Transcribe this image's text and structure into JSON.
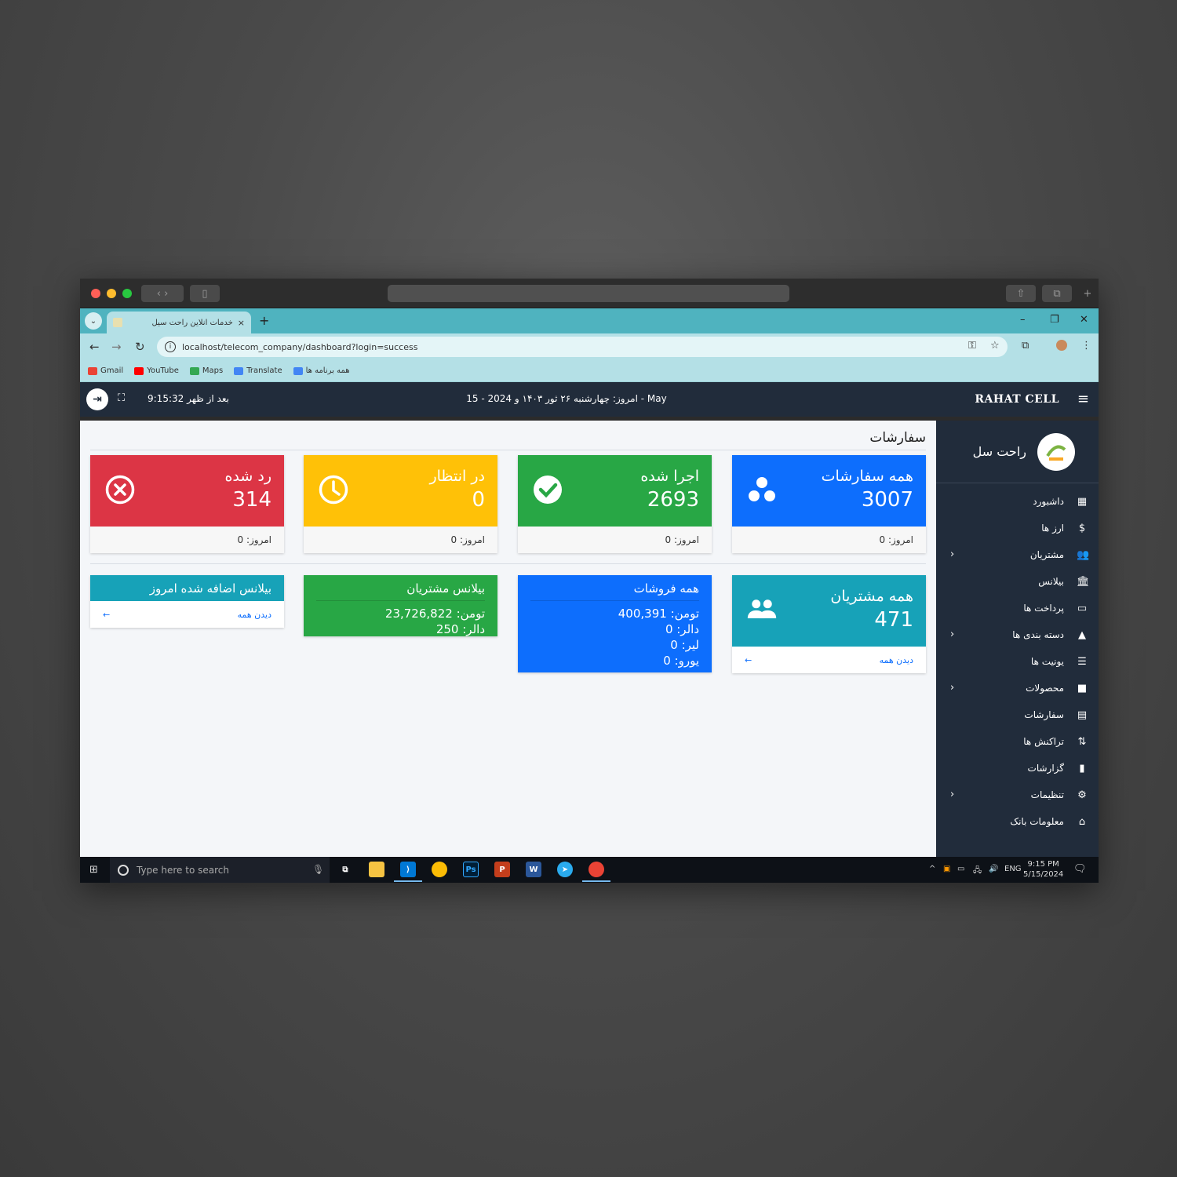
{
  "browser": {
    "tab_title": "خدمات آنلاین راحت سیل",
    "tab_close": "×",
    "new_tab": "+",
    "url": "localhost/telecom_company/dashboard?login=success",
    "bookmarks": [
      {
        "label": "Gmail",
        "color": "#ea4335"
      },
      {
        "label": "YouTube",
        "color": "#ff0000"
      },
      {
        "label": "Maps",
        "color": "#34a853"
      },
      {
        "label": "Translate",
        "color": "#4285f4"
      },
      {
        "label": "همه برنامه ها",
        "color": "#4285f4"
      }
    ]
  },
  "header": {
    "clock": "9:15:32 بعد از ظهر",
    "today": "امروز: چهارشنبه ۲۶ ثور ۱۴۰۳ و 2024 - 15 - May",
    "brand": "RAHAT CELL"
  },
  "page": {
    "title": "سفارشات"
  },
  "order_cards": [
    {
      "label": "همه سفارشات",
      "value": "3007",
      "today": "امروز: 0",
      "color": "#0d6efd",
      "icon": "circles-icon"
    },
    {
      "label": "اجرا شده",
      "value": "2693",
      "today": "امروز: 0",
      "color": "#28a745",
      "icon": "check-circle-icon"
    },
    {
      "label": "در انتظار",
      "value": "0",
      "today": "امروز: 0",
      "color": "#ffc107",
      "icon": "clock-icon"
    },
    {
      "label": "رد شده",
      "value": "314",
      "today": "امروز: 0",
      "color": "#dc3545",
      "icon": "x-circle-icon"
    }
  ],
  "customers_card": {
    "label": "همه مشتریان",
    "value": "471",
    "view_all": "دیدن همه",
    "color": "#17a2b8"
  },
  "sales_card": {
    "title": "همه فروشات",
    "lines": [
      "تومن: 400,391",
      "دالر: 0",
      "لیر: 0",
      "یورو: 0"
    ],
    "color": "#0d6efd"
  },
  "balance_card": {
    "title": "بیلانس مشتریان",
    "lines": [
      "تومن: 23,726,822",
      "دالر: 250"
    ],
    "color": "#28a745"
  },
  "today_balance_card": {
    "title": "بیلانس اضافه شده امروز",
    "view_all": "دیدن همه",
    "color": "#17a2b8"
  },
  "sidebar": {
    "profile_name": "راحت سل",
    "items": [
      {
        "label": "داشبورد",
        "icon": "▦",
        "arrow": ""
      },
      {
        "label": "ارز ها",
        "icon": "$",
        "arrow": ""
      },
      {
        "label": "مشتریان",
        "icon": "👥",
        "arrow": "›"
      },
      {
        "label": "بیلانس",
        "icon": "🏛",
        "arrow": ""
      },
      {
        "label": "پرداخت ها",
        "icon": "▭",
        "arrow": ""
      },
      {
        "label": "دسته بندی ها",
        "icon": "▲",
        "arrow": "›"
      },
      {
        "label": "یونیت ها",
        "icon": "☰",
        "arrow": ""
      },
      {
        "label": "محصولات",
        "icon": "■",
        "arrow": "›"
      },
      {
        "label": "سفارشات",
        "icon": "▤",
        "arrow": ""
      },
      {
        "label": "تراکنش ها",
        "icon": "⇅",
        "arrow": ""
      },
      {
        "label": "گزارشات",
        "icon": "▮",
        "arrow": ""
      },
      {
        "label": "تنظیمات",
        "icon": "⚙",
        "arrow": "›"
      },
      {
        "label": "معلومات بانک",
        "icon": "⌂",
        "arrow": ""
      }
    ]
  },
  "taskbar": {
    "search_placeholder": "Type here to search",
    "lang": "ENG",
    "time": "9:15 PM",
    "date": "5/15/2024"
  }
}
